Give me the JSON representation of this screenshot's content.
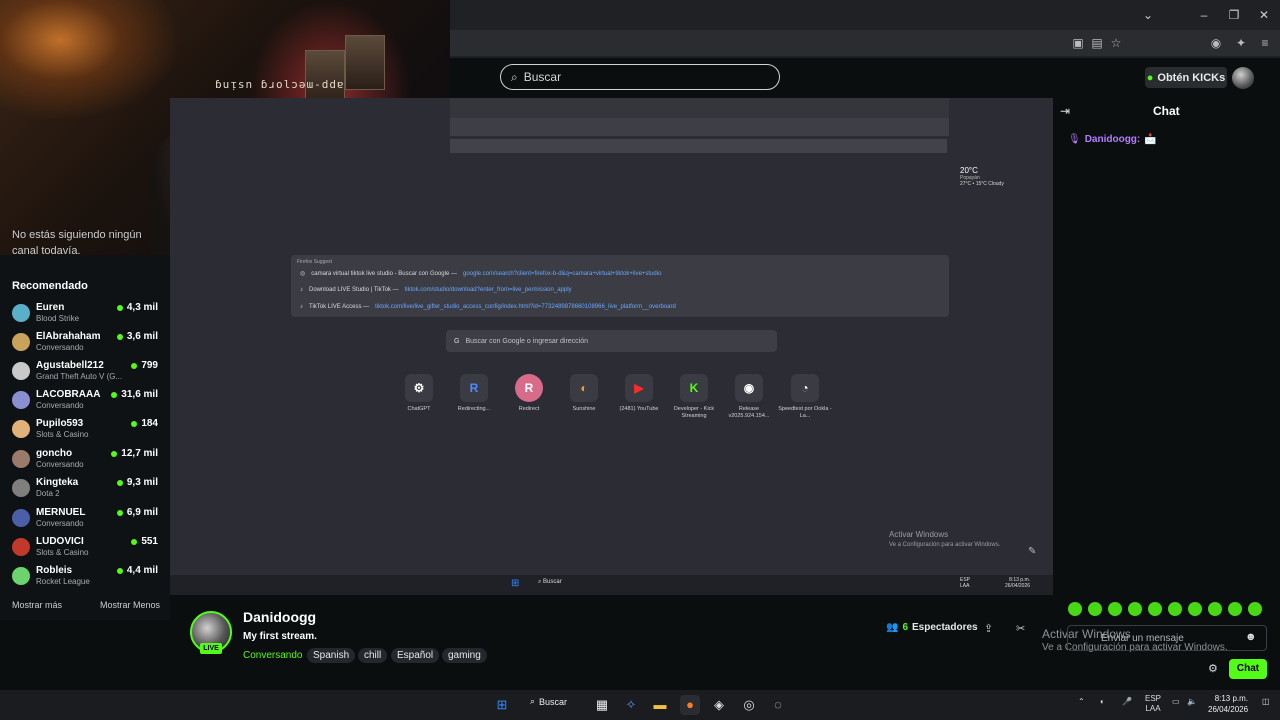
{
  "webcam": {
    "mirrored_text": "ɓuᴉsn ɓɹolɔǝɯ-ddɐ"
  },
  "kick_header": {
    "search_placeholder": "Buscar",
    "kicks_button": "Obtén KICKs"
  },
  "sidebar": {
    "no_follow": "No estás siguiendo ningún canal todavía.",
    "recommended_title": "Recomendado",
    "channels": [
      {
        "name": "Euren",
        "category": "Blood Strike",
        "viewers": "4,3 mil",
        "color": "#5bb0c9"
      },
      {
        "name": "ElAbrahaham",
        "category": "Conversando",
        "viewers": "3,6 mil",
        "color": "#c9a35b"
      },
      {
        "name": "Agustabell212",
        "category": "Grand Theft Auto V (G...",
        "viewers": "799",
        "color": "#c9c9c9"
      },
      {
        "name": "LACOBRAAA",
        "category": "Conversando",
        "viewers": "31,6 mil",
        "color": "#8a8fd0"
      },
      {
        "name": "Pupilo593",
        "category": "Slots & Casino",
        "viewers": "184",
        "color": "#e0b27a"
      },
      {
        "name": "goncho",
        "category": "Conversando",
        "viewers": "12,7 mil",
        "color": "#9a7a6a"
      },
      {
        "name": "Kingteka",
        "category": "Dota 2",
        "viewers": "9,3 mil",
        "color": "#7f7f7f"
      },
      {
        "name": "MERNUEL",
        "category": "Conversando",
        "viewers": "6,9 mil",
        "color": "#4a5fa8"
      },
      {
        "name": "LUDOVICI",
        "category": "Slots & Casino",
        "viewers": "551",
        "color": "#c0392b"
      },
      {
        "name": "Robleis",
        "category": "Rocket League",
        "viewers": "4,4 mil",
        "color": "#6cd46c"
      }
    ],
    "show_more": "Mostrar más",
    "show_less": "Mostrar Menos"
  },
  "stream_screen": {
    "suggest_header": "Firefox Suggest",
    "suggestions": [
      {
        "text": "camara virtual tiktok live studio - Buscar con Google —",
        "url": "google.com/search?client=firefox-b-d&q=camara+virtual+tiktok+live+studio"
      },
      {
        "text": "Download LIVE Studio | TikTok —",
        "url": "tiktok.com/studio/download?enter_from=live_permission_apply"
      },
      {
        "text": "TikTok LIVE Access —",
        "url": "tiktok.com/live/live_gifter_studio_access_config/index.html?id=7732489878660108966_live_platform__overboard"
      }
    ],
    "search_placeholder": "Buscar con Google o ingresar dirección",
    "shortcuts": [
      {
        "label": "ChatGPT",
        "glyph": "⚙",
        "color": "#ffffff"
      },
      {
        "label": "Redirecting...",
        "glyph": "R",
        "color": "#4a8cff"
      },
      {
        "label": "Redirect",
        "glyph": "R",
        "color": "#d96b8a"
      },
      {
        "label": "Sunshine",
        "glyph": "◐",
        "color": "#f0a030"
      },
      {
        "label": "(2481) YouTube",
        "glyph": "▶",
        "color": "#ff2a2a"
      },
      {
        "label": "Developer - Kick Streaming",
        "glyph": "K",
        "color": "#53fc18"
      },
      {
        "label": "Release v2025.924.154...",
        "glyph": "◉",
        "color": "#ffffff"
      },
      {
        "label": "Speedtest por Ookla - La...",
        "glyph": "◔",
        "color": "#ffffff"
      }
    ],
    "weather_temp": "20°C",
    "weather_loc": "Popayán",
    "weather_desc": "27°C • 15°C  Cloudy",
    "activar_title": "Activar Windows",
    "activar_sub": "Ve a Configuración para activar Windows.",
    "taskbar_search": "Buscar",
    "tray_lang": "ESP LAA",
    "tray_time": "8:13 p.m.",
    "tray_date": "26/04/2026"
  },
  "stream_info": {
    "streamer": "Danidoogg",
    "live_label": "LIVE",
    "title": "My first stream.",
    "category": "Conversando",
    "tags": [
      "Spanish",
      "chill",
      "Español",
      "gaming"
    ],
    "viewer_count": "6",
    "viewer_label": "Espectadores"
  },
  "chat": {
    "title": "Chat",
    "messages": [
      {
        "user": "Danidoogg:",
        "emote": "📩"
      }
    ],
    "input_placeholder": "Enviar un mensaje",
    "send_label": "Chat",
    "activar_title": "Activar Windows",
    "activar_sub": "Ve a Configuración para activar Windows."
  },
  "taskbar": {
    "search_label": "Buscar",
    "lang": "ESP",
    "lang_sub": "LAA",
    "time": "8:13 p.m.",
    "date": "26/04/2026"
  }
}
